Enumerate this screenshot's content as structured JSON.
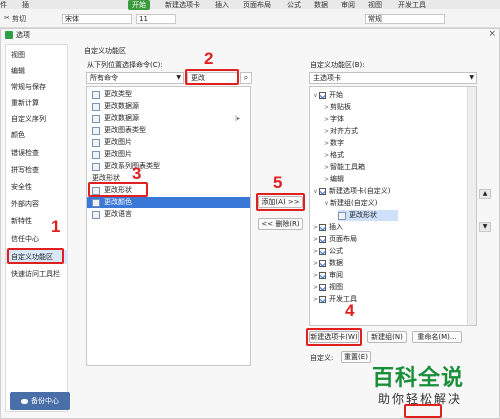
{
  "ribbon": {
    "tabs": [
      "开始",
      "新建选项卡",
      "插入",
      "页面布局",
      "公式",
      "数据",
      "审阅",
      "视图",
      "开发工具"
    ],
    "active_tab": "开始",
    "cut_label": "剪切",
    "font_value": "宋体",
    "size_value": "11",
    "number_format": "常规"
  },
  "dialog": {
    "title": "选项",
    "close": "×"
  },
  "nav": {
    "items": [
      "视图",
      "编辑",
      "常规与保存",
      "重新计算",
      "自定义序列",
      "颜色",
      "错误检查",
      "拼写检查",
      "安全性",
      "外部内容",
      "新特性",
      "信任中心",
      "自定义功能区",
      "快速访问工具栏"
    ],
    "selected": "自定义功能区",
    "backup_label": "备份中心"
  },
  "section_title": "自定义功能区",
  "left_panel": {
    "label": "从下列位置选择命令(C):",
    "source_value": "所有命令",
    "search_value": "更改",
    "commands": [
      {
        "text": "更改类型",
        "kind": "item"
      },
      {
        "text": "更改数据源",
        "kind": "item"
      },
      {
        "text": "更改数据源",
        "kind": "item",
        "sub": "|▸"
      },
      {
        "text": "更改图表类型",
        "kind": "item"
      },
      {
        "text": "更改图片",
        "kind": "item"
      },
      {
        "text": "更改图片",
        "kind": "item"
      },
      {
        "text": "更改系列图表类型",
        "kind": "item"
      },
      {
        "text": "更改形状",
        "kind": "group"
      },
      {
        "text": "更改形状",
        "kind": "item"
      },
      {
        "text": "更改颜色",
        "kind": "selected"
      },
      {
        "text": "更改语言",
        "kind": "item"
      }
    ]
  },
  "middle": {
    "add_label": "添加(A) >>",
    "remove_label": "<< 删除(R)"
  },
  "right_panel": {
    "label": "自定义功能区(B):",
    "scope_value": "主选项卡",
    "tree": [
      {
        "text": "开始",
        "level": 0,
        "chev": "∨",
        "checked": true
      },
      {
        "text": "剪贴板",
        "level": 1,
        "chev": ">",
        "checked": false
      },
      {
        "text": "字体",
        "level": 1,
        "chev": ">",
        "checked": false
      },
      {
        "text": "对齐方式",
        "level": 1,
        "chev": ">",
        "checked": false
      },
      {
        "text": "数字",
        "level": 1,
        "chev": ">",
        "checked": false
      },
      {
        "text": "格式",
        "level": 1,
        "chev": ">",
        "checked": false
      },
      {
        "text": "智能工具箱",
        "level": 1,
        "chev": ">",
        "checked": false
      },
      {
        "text": "编辑",
        "level": 1,
        "chev": ">",
        "checked": false
      },
      {
        "text": "新建选项卡(自定义)",
        "level": 0,
        "chev": "∨",
        "checked": true
      },
      {
        "text": "新建组(自定义)",
        "level": 1,
        "chev": "∨",
        "checked": false
      },
      {
        "text": "更改形状",
        "level": 2,
        "chev": "",
        "checked": false,
        "icon": true,
        "selected": true
      },
      {
        "text": "插入",
        "level": 0,
        "chev": ">",
        "checked": true
      },
      {
        "text": "页面布局",
        "level": 0,
        "chev": ">",
        "checked": true
      },
      {
        "text": "公式",
        "level": 0,
        "chev": ">",
        "checked": true
      },
      {
        "text": "数据",
        "level": 0,
        "chev": ">",
        "checked": true
      },
      {
        "text": "审阅",
        "level": 0,
        "chev": ">",
        "checked": true
      },
      {
        "text": "视图",
        "level": 0,
        "chev": ">",
        "checked": true
      },
      {
        "text": "开发工具",
        "level": 0,
        "chev": ">",
        "checked": true
      }
    ],
    "new_tab_label": "新建选项卡(W)",
    "new_group_label": "新建组(N)",
    "rename_label": "重命名(M)...",
    "customize_label": "自定义:",
    "reset_label": "重置(E)"
  },
  "annotations": [
    "1",
    "2",
    "3",
    "4",
    "5"
  ],
  "watermark": {
    "brand": "百科全说",
    "sub": "助你轻松解决"
  },
  "colors": {
    "accent_green": "#3c9b3c",
    "highlight_red": "#e02020",
    "selection_blue": "#3a78d8",
    "brand_green": "#1a8f3a"
  }
}
